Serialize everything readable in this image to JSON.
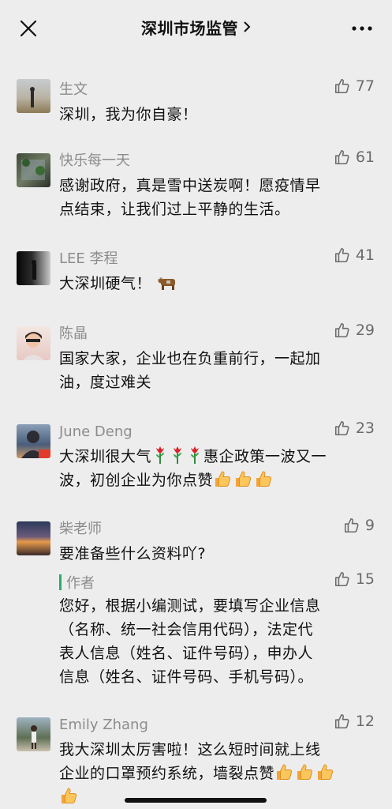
{
  "header": {
    "title": "深圳市场监管",
    "chevron": "chevron-right-icon",
    "close_icon": "close-icon",
    "more_icon": "more-icon"
  },
  "comments": [
    {
      "name": "生文",
      "likes": "77",
      "text": "深圳，我为你自豪！"
    },
    {
      "name": "快乐每一天",
      "likes": "61",
      "text_lines": [
        "感谢政府，真是雪中送炭啊！愿疫情早",
        "点结束，让我们过上平静的生活。"
      ]
    },
    {
      "name": "LEE 李程",
      "likes": "41",
      "text": "大深圳硬气！",
      "emoji": "cow"
    },
    {
      "name": "陈晶",
      "likes": "29",
      "text_lines": [
        "国家大家，企业也在负重前行，一起加",
        "油，度过难关"
      ]
    },
    {
      "name": "June Deng",
      "likes": "23",
      "text_line1_a": "大深圳很大气",
      "text_line1_b": "惠企政策一波又一",
      "text_line2": "波，初创企业为你点赞"
    },
    {
      "name": "柴老师",
      "likes": "9",
      "text": "要准备些什么资料吖?",
      "reply": {
        "label": "作者",
        "likes": "15",
        "text_lines": [
          "您好，根据小编测试，要填写企业信息",
          "（名称、统一社会信用代码），法定代",
          "表人信息（姓名、证件号码），申办人",
          "信息（姓名、证件号码、手机号码）。"
        ]
      }
    },
    {
      "name": "Emily Zhang",
      "likes": "12",
      "text_lines": [
        "我大深圳太厉害啦！这么短时间就上线",
        "企业的口罩预约系统，墙裂点赞"
      ]
    }
  ],
  "colors": {
    "background": "#ededed",
    "author_bar": "#2aae67",
    "meta_text": "#8c8c8c"
  }
}
